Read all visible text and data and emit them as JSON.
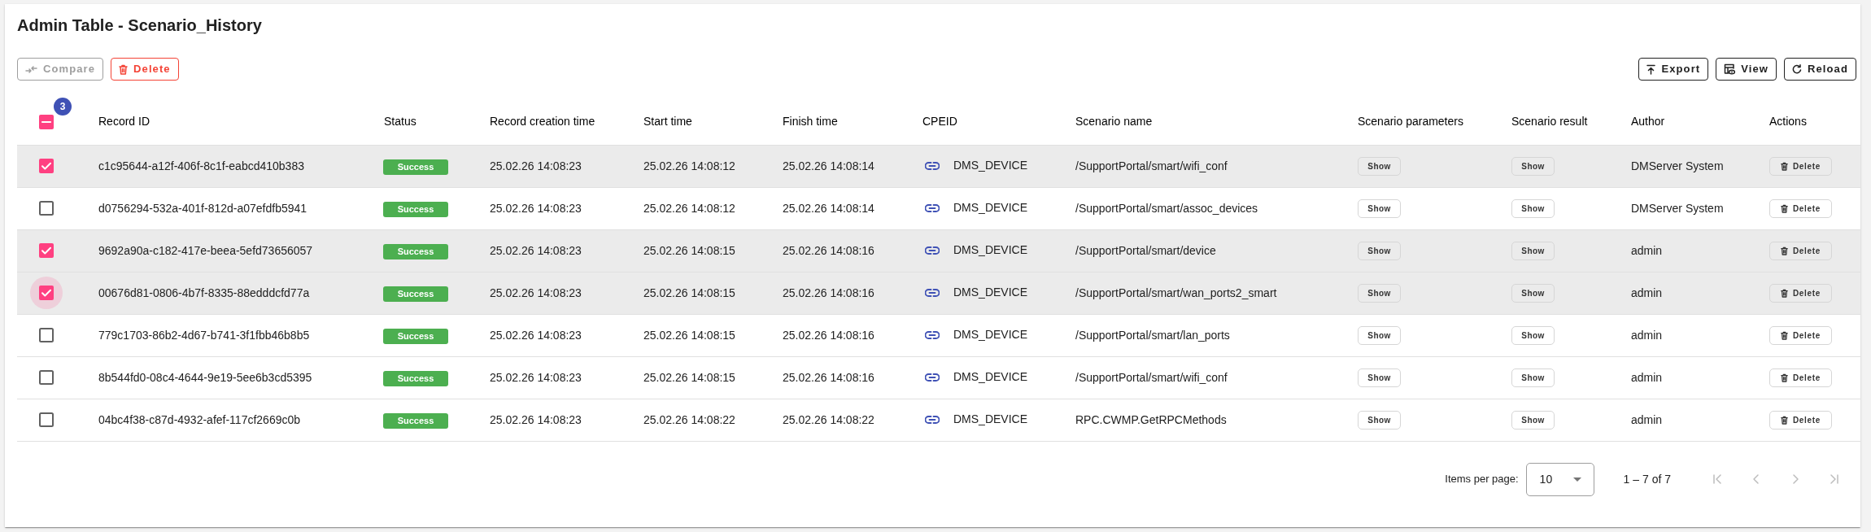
{
  "page": {
    "title": "Admin Table - Scenario_History"
  },
  "toolbar": {
    "left": [
      {
        "kind": "compare",
        "label": "Compare",
        "disabled": true
      },
      {
        "kind": "delete",
        "label": "Delete",
        "disabled": false
      }
    ],
    "right": [
      {
        "kind": "export",
        "label": "Export"
      },
      {
        "kind": "view",
        "label": "View"
      },
      {
        "kind": "reload",
        "label": "Reload"
      }
    ]
  },
  "table": {
    "select_all": {
      "indeterminate": true,
      "selected_count": "3"
    },
    "columns": [
      "Record ID",
      "Status",
      "Record creation time",
      "Start time",
      "Finish time",
      "CPEID",
      "Scenario name",
      "Scenario parameters",
      "Scenario result",
      "Author",
      "Actions"
    ],
    "rows": [
      {
        "selected": true,
        "focused": false,
        "record_id": "c1c95644-a12f-406f-8c1f-eabcd410b383",
        "status": "Success",
        "created": "25.02.26 14:08:23",
        "start": "25.02.26 14:08:12",
        "finish": "25.02.26 14:08:14",
        "cpeid": "DMS_DEVICE",
        "scenario_name": "/SupportPortal/smart/wifi_conf",
        "parameters": "Show",
        "result": "Show",
        "author": "DMServer System",
        "action": "Delete"
      },
      {
        "selected": false,
        "focused": false,
        "record_id": "d0756294-532a-401f-812d-a07efdfb5941",
        "status": "Success",
        "created": "25.02.26 14:08:23",
        "start": "25.02.26 14:08:12",
        "finish": "25.02.26 14:08:14",
        "cpeid": "DMS_DEVICE",
        "scenario_name": "/SupportPortal/smart/assoc_devices",
        "parameters": "Show",
        "result": "Show",
        "author": "DMServer System",
        "action": "Delete"
      },
      {
        "selected": true,
        "focused": false,
        "record_id": "9692a90a-c182-417e-beea-5efd73656057",
        "status": "Success",
        "created": "25.02.26 14:08:23",
        "start": "25.02.26 14:08:15",
        "finish": "25.02.26 14:08:16",
        "cpeid": "DMS_DEVICE",
        "scenario_name": "/SupportPortal/smart/device",
        "parameters": "Show",
        "result": "Show",
        "author": "admin",
        "action": "Delete"
      },
      {
        "selected": true,
        "focused": true,
        "record_id": "00676d81-0806-4b7f-8335-88edddcfd77a",
        "status": "Success",
        "created": "25.02.26 14:08:23",
        "start": "25.02.26 14:08:15",
        "finish": "25.02.26 14:08:16",
        "cpeid": "DMS_DEVICE",
        "scenario_name": "/SupportPortal/smart/wan_ports2_smart",
        "parameters": "Show",
        "result": "Show",
        "author": "admin",
        "action": "Delete"
      },
      {
        "selected": false,
        "focused": false,
        "record_id": "779c1703-86b2-4d67-b741-3f1fbb46b8b5",
        "status": "Success",
        "created": "25.02.26 14:08:23",
        "start": "25.02.26 14:08:15",
        "finish": "25.02.26 14:08:16",
        "cpeid": "DMS_DEVICE",
        "scenario_name": "/SupportPortal/smart/lan_ports",
        "parameters": "Show",
        "result": "Show",
        "author": "admin",
        "action": "Delete"
      },
      {
        "selected": false,
        "focused": false,
        "record_id": "8b544fd0-08c4-4644-9e19-5ee6b3cd5395",
        "status": "Success",
        "created": "25.02.26 14:08:23",
        "start": "25.02.26 14:08:15",
        "finish": "25.02.26 14:08:16",
        "cpeid": "DMS_DEVICE",
        "scenario_name": "/SupportPortal/smart/wifi_conf",
        "parameters": "Show",
        "result": "Show",
        "author": "admin",
        "action": "Delete"
      },
      {
        "selected": false,
        "focused": false,
        "record_id": "04bc4f38-c87d-4932-afef-117cf2669c0b",
        "status": "Success",
        "created": "25.02.26 14:08:23",
        "start": "25.02.26 14:08:22",
        "finish": "25.02.26 14:08:22",
        "cpeid": "DMS_DEVICE",
        "scenario_name": "RPC.CWMP.GetRPCMethods",
        "parameters": "Show",
        "result": "Show",
        "author": "admin",
        "action": "Delete"
      }
    ]
  },
  "pagination": {
    "label": "Items per page:",
    "page_size": "10",
    "range": "1 – 7 of 7",
    "nav": [
      {
        "kind": "first",
        "disabled": true
      },
      {
        "kind": "previous",
        "disabled": true
      },
      {
        "kind": "next",
        "disabled": true
      },
      {
        "kind": "last",
        "disabled": true
      }
    ]
  }
}
